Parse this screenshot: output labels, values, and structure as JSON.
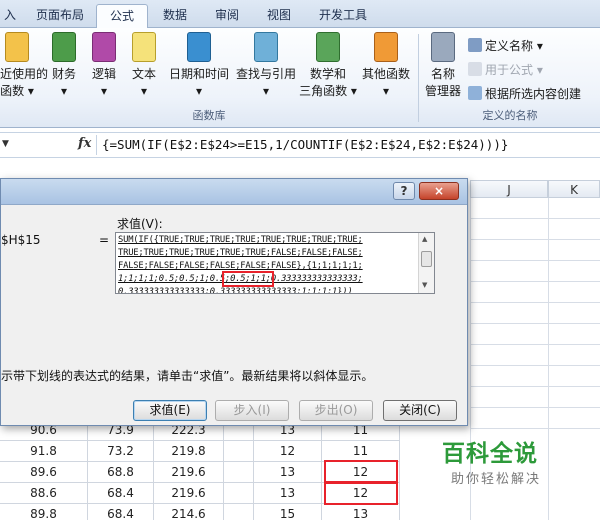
{
  "ribbon_tabs": [
    "入",
    "页面布局",
    "公式",
    "数据",
    "审阅",
    "视图",
    "开发工具"
  ],
  "ribbon": {
    "function_library": {
      "buttons": [
        {
          "line1": "最近使用的",
          "line2": "函数 ▾"
        },
        {
          "line1": "财务",
          "line2": "▾"
        },
        {
          "line1": "逻辑",
          "line2": "▾"
        },
        {
          "line1": "文本",
          "line2": "▾"
        },
        {
          "line1": "日期和时间",
          "line2": "▾"
        },
        {
          "line1": "查找与引用",
          "line2": "▾"
        },
        {
          "line1": "数学和",
          "line2": "三角函数 ▾"
        },
        {
          "line1": "其他函数",
          "line2": "▾"
        }
      ],
      "group_label": "函数库"
    },
    "defined_names": {
      "name_manager": {
        "line1": "名称",
        "line2": "管理器"
      },
      "define_name": "定义名称 ▾",
      "use_in_formula": "用于公式 ▾",
      "create_from_selection": "根据所选内容创建",
      "group_label": "定义的名称"
    }
  },
  "formula_bar": {
    "fx": "fx",
    "formula": "{=SUM(IF(E$2:E$24>=E15,1/COUNTIF(E$2:E$24,E$2:E$24)))}"
  },
  "sheet": {
    "col_headers": [
      "J",
      "K"
    ],
    "rows": [
      [
        "90.6",
        "73.9",
        "222.3",
        "13",
        "11"
      ],
      [
        "91.8",
        "73.2",
        "219.8",
        "12",
        "11"
      ],
      [
        "89.6",
        "68.8",
        "219.6",
        "13",
        "12"
      ],
      [
        "88.6",
        "68.4",
        "219.6",
        "13",
        "12"
      ],
      [
        "89.8",
        "68.4",
        "214.6",
        "15",
        "13"
      ]
    ]
  },
  "dialog": {
    "title_buttons": {
      "help": "?",
      "close": "×"
    },
    "reference_label": "$H$15",
    "equals": "=",
    "evaluation_label": "求值(V):",
    "evaluation_lines": [
      "SUM(IF({TRUE;TRUE;TRUE;TRUE;TRUE;TRUE;TRUE;TRUE;",
      "TRUE;TRUE;TRUE;TRUE;TRUE;TRUE;FALSE;FALSE;FALSE;",
      "FALSE;FALSE;FALSE;FALSE;FALSE;FALSE},{1;1;1;1;1;",
      "1;1;1;1;0.5;0.5;1;0.5;0.5;1;1;0.333333333333333;",
      "0.333333333333333;0.333333333333333;1;1;1;1}))"
    ],
    "hint": "示带下划线的表达式的结果，请单击“求值”。最新结果将以斜体显示。",
    "buttons": {
      "evaluate": "求值(E)",
      "step_in": "步入(I)",
      "step_out": "步出(O)",
      "close": "关闭(C)"
    }
  },
  "watermark": {
    "title": "百科全说",
    "subtitle": "助你轻松解决"
  },
  "colors": {
    "highlight_red": "#e8222b",
    "watermark_green": "#2d9a3a"
  }
}
